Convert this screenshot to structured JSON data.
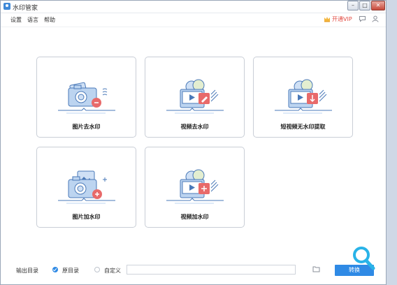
{
  "app": {
    "title": "水印管家"
  },
  "menu": [
    "设置",
    "语言",
    "帮助"
  ],
  "header": {
    "vip_label": "开通VIP"
  },
  "cards": [
    {
      "label": "图片去水印",
      "icon": "photo-remove-watermark-icon"
    },
    {
      "label": "视频去水印",
      "icon": "video-remove-watermark-icon"
    },
    {
      "label": "短视频无水印提取",
      "icon": "short-video-extract-icon"
    },
    {
      "label": "图片加水印",
      "icon": "photo-add-watermark-icon"
    },
    {
      "label": "视频加水印",
      "icon": "video-add-watermark-icon"
    }
  ],
  "bottom": {
    "output_label": "输出目录",
    "option_original": "原目录",
    "option_custom": "自定义",
    "path_value": "",
    "convert_label": "转换"
  },
  "colors": {
    "accent": "#2f8ae5",
    "vip": "#e24b42",
    "badge": "#e86a6a",
    "icon_line": "#4a79b8"
  }
}
